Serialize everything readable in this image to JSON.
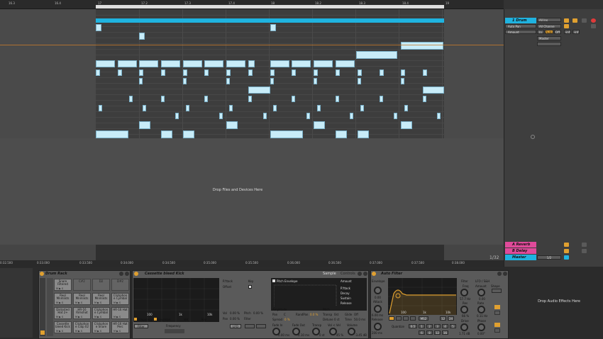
{
  "ruler_top": {
    "labels": [
      "16.3",
      "16.4",
      "17",
      "17.2",
      "17.3",
      "17.4",
      "18",
      "18.2",
      "18.3",
      "18.4",
      "19"
    ]
  },
  "ruler_bottom": {
    "labels": [
      "0:32.500",
      "0:33.000",
      "0:33.500",
      "0:34.000",
      "0:34.500",
      "0:35.000",
      "0:35.500",
      "0:36.000",
      "0:36.500",
      "0:37.000",
      "0:37.500",
      "0:38.000"
    ]
  },
  "arrangement": {
    "drop_files_label": "Drop Files and Devices Here"
  },
  "mixer": {
    "tracks": [
      {
        "name": "1 Drum Rack",
        "color": "#1fb3e0",
        "input": "All Ins",
        "channel": "All Channe",
        "monitor": "Auto",
        "route": "Master"
      },
      {
        "name": "A Reverb",
        "color": "#e04a9a"
      },
      {
        "name": "B Delay",
        "color": "#e04a9a"
      },
      {
        "name": "Master",
        "color": "#1fb3e0"
      }
    ],
    "auto_pan": "Auto Pan",
    "amount": "Amount",
    "monitor_in": "In",
    "monitor_auto": "Auto",
    "monitor_off": "Off",
    "inf1": "-inf",
    "inf2": "-inf",
    "master_level": "1/2",
    "tempo": "1/32"
  },
  "drum_rack": {
    "title": "Drum Rack",
    "pads": [
      {
        "name": "Snare Filtered",
        "empty": false
      },
      {
        "name": "C#2",
        "empty": true
      },
      {
        "name": "D2",
        "empty": true
      },
      {
        "name": "D#2",
        "empty": true
      },
      {
        "name": "Reel Mnmlists",
        "empty": false
      },
      {
        "name": "Reel Mnmlists",
        "empty": false
      },
      {
        "name": "Reel Mnmlists",
        "empty": false
      },
      {
        "name": "Clickphon e Cymbal",
        "empty": false
      },
      {
        "name": "Distorted Hat 2+",
        "empty": false
      },
      {
        "name": "HR-16 Rimshot",
        "empty": false
      },
      {
        "name": "Clickphon e Cymbal",
        "empty": false
      },
      {
        "name": "HR-16 Hat",
        "empty": false
      },
      {
        "name": "Cassette bleed Kick",
        "empty": false
      },
      {
        "name": "Clickphon e Clap 02",
        "empty": false
      },
      {
        "name": "Clickphon e Snare",
        "empty": false
      },
      {
        "name": "HR-16 Hat Perc",
        "empty": false
      }
    ],
    "msr": "M ▶ S"
  },
  "sampler": {
    "title": "Cassette bleed Kick",
    "tab_sample": "Sample",
    "tab_controls": "Controls",
    "attack": "R'ttack",
    "offset": "Offset",
    "key": "Key",
    "vol": "Vol",
    "vol_val": "0.00 %",
    "pitch": "Pitch",
    "pitch_val": "0.00 %",
    "pan": "Pan",
    "pan_val": "0.00 %",
    "filter": "Filter",
    "frequency": "Frequency",
    "envelope_chk": "Envelope",
    "vel": "Vel",
    "key2": "Key",
    "filter_btn": "Filter",
    "lfo_btn": "LFO",
    "pitch_env": "Pitch Envelope",
    "amount": "Amount",
    "env_labels": [
      "R'ttack",
      "Decay",
      "Sustain",
      "Release"
    ],
    "amplitude": "Amplitude",
    "pitch2": "Pitch",
    "pan2": "Pan",
    "pan2_val": "C",
    "rand_pan": "RandPan",
    "rand_pan_val": "0.0 %",
    "transp": "Transp",
    "transp_val": "0st",
    "glide": "Glide",
    "glide_val": "Off",
    "spread": "Spread",
    "spread_val": "0 %",
    "detune": "Detune",
    "detune_val": "0 ct",
    "time": "Time",
    "time_val": "50.0 ms",
    "fade_in": "Fade In",
    "fade_in_val": "0.00 ms",
    "fade_out": "Fade Out",
    "fade_out_val": "0.10 ms",
    "transp2": "Transp",
    "transp2_val": "0 st",
    "vol_vel": "Vol < Vel",
    "vol_vel_val": "45 %",
    "volume": "Volume",
    "volume_val": "-3.45 dB",
    "freq_labels": [
      "100",
      "1k",
      "10k"
    ]
  },
  "autofilter": {
    "title": "Auto Filter",
    "envelope": "Envelope",
    "env_val": "0.00",
    "attack": "Attack",
    "attack_val": "6.00 ms",
    "release": "Release",
    "release_val": "200 ms",
    "freq_labels": [
      "100",
      "1k",
      "10k"
    ],
    "filter": "Filter",
    "freq": "Freq",
    "freq_val": "57.7 Hz",
    "res": "Res",
    "res_val": "66 %",
    "drive": "Drive",
    "drive_val": "1.71 dB",
    "lfo": "LFO / S&H",
    "amount": "Amount",
    "amount_val": "0.00",
    "shape": "Shape",
    "rate": "Rate",
    "rate_val": "0.11 Hz",
    "phase": "Phase",
    "phase_val": "0.00°",
    "quantize": "Quantize",
    "quantize_val": "0.5",
    "ms2": "MS2",
    "q_steps": [
      "1",
      "2",
      "3",
      "4",
      "5",
      "6",
      "8",
      "12",
      "16"
    ],
    "db12": "12",
    "db24": "24"
  },
  "drop_fx": "Drop Audio Effects Here"
}
